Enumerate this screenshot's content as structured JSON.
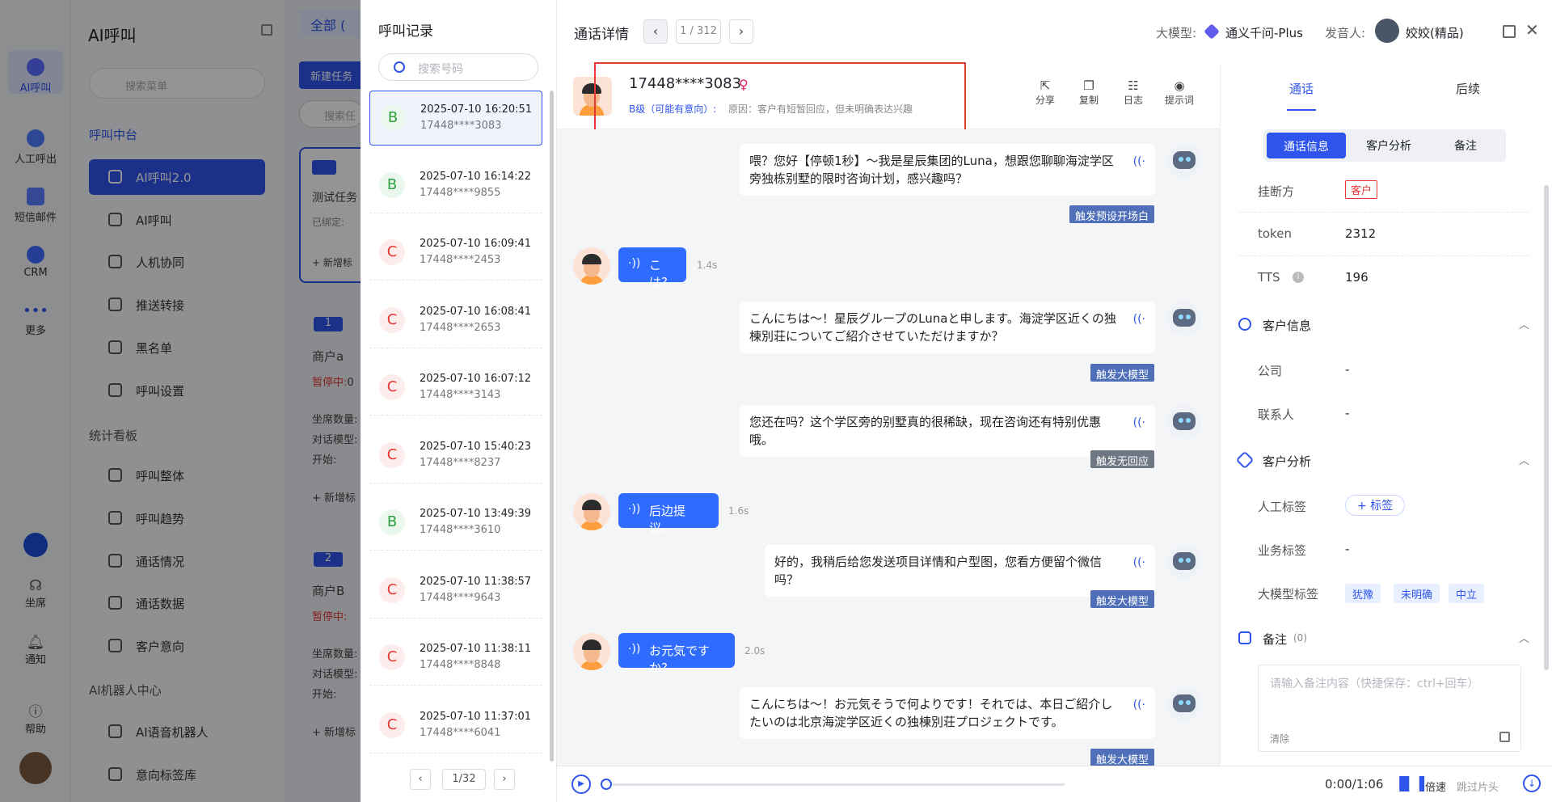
{
  "rail": {
    "items": [
      {
        "label": "AI呼叫"
      },
      {
        "label": "人工呼出"
      },
      {
        "label": "短信邮件"
      },
      {
        "label": "CRM"
      },
      {
        "label": "更多"
      },
      {
        "label": "坐席"
      },
      {
        "label": "通知"
      },
      {
        "label": "帮助"
      }
    ]
  },
  "menu": {
    "title": "AI呼叫",
    "search_placeholder": "搜索菜单",
    "group1": "呼叫中台",
    "items1": [
      "AI呼叫2.0",
      "AI呼叫",
      "人机协同",
      "推送转接",
      "黑名单",
      "呼叫设置"
    ],
    "group2": "统计看板",
    "items2": [
      "呼叫整体",
      "呼叫趋势",
      "通话情况",
      "通话数据",
      "客户意向"
    ],
    "group3": "AI机器人中心",
    "items3": [
      "AI语音机器人",
      "意向标签库"
    ]
  },
  "tasks": {
    "tab_all": "全部",
    "tab_count": "(",
    "new_task": "新建任务",
    "search": "搜索任",
    "task1_name": "测试任务",
    "task1_bound": "已绑定:",
    "add_tag": "+ 新增标",
    "num1": "1",
    "merchant_a": "商户a",
    "paused": "暂停中:",
    "paused_v": "0",
    "seats": "坐席数量:",
    "model": "对话模型:",
    "start": "开始:",
    "num2": "2",
    "merchant_b": "商户B"
  },
  "calls": {
    "title": "呼叫记录",
    "search_placeholder": "搜索号码",
    "items": [
      {
        "grade": "B",
        "time": "2025-07-10 16:20:51",
        "phone": "17448****3083"
      },
      {
        "grade": "B",
        "time": "2025-07-10 16:14:22",
        "phone": "17448****9855"
      },
      {
        "grade": "C",
        "time": "2025-07-10 16:09:41",
        "phone": "17448****2453"
      },
      {
        "grade": "C",
        "time": "2025-07-10 16:08:41",
        "phone": "17448****2653"
      },
      {
        "grade": "C",
        "time": "2025-07-10 16:07:12",
        "phone": "17448****3143"
      },
      {
        "grade": "C",
        "time": "2025-07-10 15:40:23",
        "phone": "17448****8237"
      },
      {
        "grade": "B",
        "time": "2025-07-10 13:49:39",
        "phone": "17448****3610"
      },
      {
        "grade": "C",
        "time": "2025-07-10 11:38:57",
        "phone": "17448****9643"
      },
      {
        "grade": "C",
        "time": "2025-07-10 11:38:11",
        "phone": "17448****8848"
      },
      {
        "grade": "C",
        "time": "2025-07-10 11:37:01",
        "phone": "17448****6041"
      }
    ],
    "page": "1/32"
  },
  "detail": {
    "title": "通话详情",
    "page": "1 / 312",
    "model_label": "大模型:",
    "model_value": "通义千问-Plus",
    "speaker_label": "发音人:",
    "speaker_value": "姣姣(精品)",
    "phone": "17448****3083",
    "grade": "B级（可能有意向）:",
    "reason": "原因：客户有短暂回应，但未明确表达兴趣",
    "actions": [
      "分享",
      "复制",
      "日志",
      "提示词"
    ]
  },
  "conversation": [
    {
      "side": "bot",
      "text": "喂？您好【停顿1秒】～我是星辰集团的Luna，想跟您聊聊海淀学区旁独栋别墅的限时咨询计划，感兴趣吗？",
      "tag": "触发预设开场白"
    },
    {
      "side": "user",
      "text": "こは?",
      "duration": "1.4s"
    },
    {
      "side": "bot",
      "text": "こんにちは～！星辰グループのLunaと申します。海淀学区近くの独棟別荘についてご紹介させていただけますか？",
      "tag": "触发大模型"
    },
    {
      "side": "bot",
      "text": "您还在吗？这个学区旁的别墅真的很稀缺，现在咨询还有特别优惠哦。",
      "tag": "触发无回应"
    },
    {
      "side": "user",
      "text": "后边提议。",
      "duration": "1.6s"
    },
    {
      "side": "bot",
      "text": "好的，我稍后给您发送项目详情和户型图，您看方便留个微信吗？",
      "tag": "触发大模型"
    },
    {
      "side": "user",
      "text": "お元気ですか?",
      "duration": "2.0s"
    },
    {
      "side": "bot",
      "text": "こんにちは～！お元気そうで何よりです！それでは、本日ご紹介したいのは北京海淀学区近くの独棟別荘プロジェクトです。",
      "tag": "触发大模型"
    }
  ],
  "right": {
    "tabs": [
      "通话",
      "后续"
    ],
    "subtabs": [
      "通话信息",
      "客户分析",
      "备注"
    ],
    "hangup_label": "挂断方",
    "hangup_value": "客户",
    "token_label": "token",
    "token_value": "2312",
    "tts_label": "TTS",
    "tts_value": "196",
    "customer_info": "客户信息",
    "company_label": "公司",
    "company_value": "-",
    "contact_label": "联系人",
    "contact_value": "-",
    "analysis": "客户分析",
    "manual_tag_label": "人工标签",
    "manual_tag_btn": "+ 标签",
    "biz_tag_label": "业务标签",
    "biz_tag_value": "-",
    "llm_tag_label": "大模型标签",
    "llm_tags": [
      "犹豫",
      "未明确",
      "中立"
    ],
    "notes": "备注",
    "notes_count": "(0)",
    "notes_placeholder": "请输入备注内容（快捷保存：ctrl+回车）",
    "clear": "清除"
  },
  "player": {
    "time": "0:00/1:06",
    "speed": "倍速",
    "skip": "跳过片头"
  },
  "colors": {
    "accent": "#2f54eb",
    "bubble": "#2f6bff",
    "highlight": "#e53935"
  }
}
